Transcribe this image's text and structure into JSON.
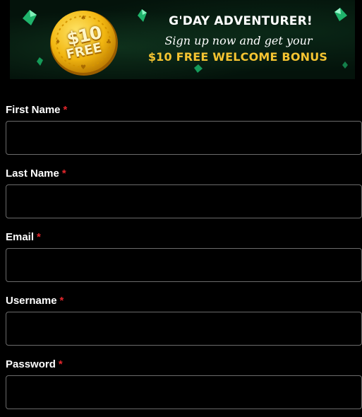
{
  "banner": {
    "coin_amount": "$10",
    "coin_free": "FREE",
    "title": "G'DAY ADVENTURER!",
    "subtitle": "Sign up now and get your",
    "bonus": "$10 FREE WELCOME BONUS",
    "accent_color": "#f5c431",
    "gem_color": "#27c77a"
  },
  "form": {
    "required_marker": "*",
    "fields": [
      {
        "label": "First Name",
        "value": "",
        "placeholder": ""
      },
      {
        "label": "Last Name",
        "value": "",
        "placeholder": ""
      },
      {
        "label": "Email",
        "value": "",
        "placeholder": ""
      },
      {
        "label": "Username",
        "value": "",
        "placeholder": ""
      },
      {
        "label": "Password",
        "value": "",
        "placeholder": ""
      }
    ]
  },
  "colors": {
    "background": "#000000",
    "input_border": "#6b6b6b",
    "required": "#e3262c"
  }
}
